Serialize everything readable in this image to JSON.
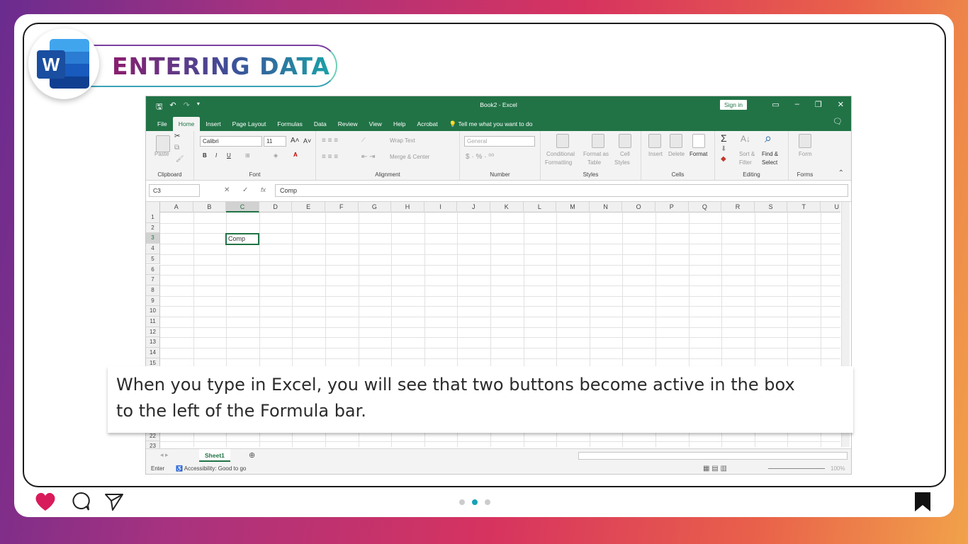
{
  "header": {
    "title": "ENTERING DATA",
    "logo_letter": "W"
  },
  "excel": {
    "document_title": "Book2  -  Excel",
    "sign_in": "Sign in",
    "tabs": [
      "File",
      "Home",
      "Insert",
      "Page Layout",
      "Formulas",
      "Data",
      "Review",
      "View",
      "Help",
      "Acrobat"
    ],
    "tell_me": "Tell me what you want to do",
    "ribbon": {
      "clipboard": {
        "label": "Clipboard",
        "paste": "Paste"
      },
      "font": {
        "label": "Font",
        "font_name": "Calibri",
        "font_size": "11"
      },
      "alignment": {
        "label": "Alignment",
        "wrap_text": "Wrap Text",
        "merge_center": "Merge & Center"
      },
      "number": {
        "label": "Number",
        "format": "General"
      },
      "styles": {
        "label": "Styles",
        "conditional": "Conditional",
        "formatting": "Formatting",
        "format_as": "Format as",
        "table": "Table",
        "cell": "Cell",
        "cell_styles": "Styles"
      },
      "cells": {
        "label": "Cells",
        "insert": "Insert",
        "delete": "Delete",
        "format": "Format"
      },
      "editing": {
        "label": "Editing",
        "sort": "Sort &",
        "filter": "Filter",
        "find": "Find &",
        "select": "Select"
      },
      "forms": {
        "label": "Forms",
        "form": "Form"
      }
    },
    "name_box": "C3",
    "formula_value": "Comp",
    "columns": [
      "A",
      "B",
      "C",
      "D",
      "E",
      "F",
      "G",
      "H",
      "I",
      "J",
      "K",
      "L",
      "M",
      "N",
      "O",
      "P",
      "Q",
      "R",
      "S",
      "T",
      "U"
    ],
    "rows": [
      "1",
      "2",
      "3",
      "4",
      "5",
      "6",
      "7",
      "8",
      "9",
      "10",
      "11",
      "12",
      "13",
      "14",
      "15"
    ],
    "bottom_rows": [
      "22",
      "23"
    ],
    "active_cell_value": "Comp",
    "sheet_tab": "Sheet1",
    "status_mode": "Enter",
    "accessibility": "Accessibility: Good to go",
    "zoom": "100%"
  },
  "caption": {
    "line1": "When you type in Excel, you will see that two buttons become active in the box",
    "line2": "to the left of the Formula bar."
  },
  "footer": {
    "active_dot": 2,
    "dot_count": 3
  },
  "colors": {
    "excel_green": "#217346",
    "heart": "#d81b5a",
    "dot_active": "#1aa0b8"
  }
}
